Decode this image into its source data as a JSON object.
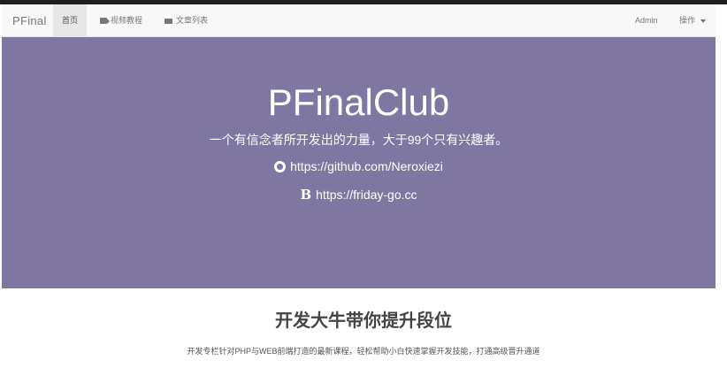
{
  "navbar": {
    "brand": "PFinal",
    "items": [
      {
        "label": "首页",
        "icon": "none"
      },
      {
        "label": "视频教程",
        "icon": "video-icon"
      },
      {
        "label": "文章列表",
        "icon": "list-icon"
      }
    ],
    "user": "Admin",
    "menu_label": "操作"
  },
  "hero": {
    "title": "PFinalClub",
    "subtitle": "一个有信念者所开发出的力量，大于99个只有兴趣者。",
    "github_url": "https://github.com/Neroxiezi",
    "site_url": "https://friday-go.cc",
    "site_icon_glyph": "B",
    "background_color": "#7f77a2"
  },
  "section": {
    "title": "开发大牛带你提升段位",
    "description": "开发专栏针对PHP与WEB前端打造的最新课程，轻松帮助小白快速掌握开发技能，打通高级晋升通道"
  }
}
